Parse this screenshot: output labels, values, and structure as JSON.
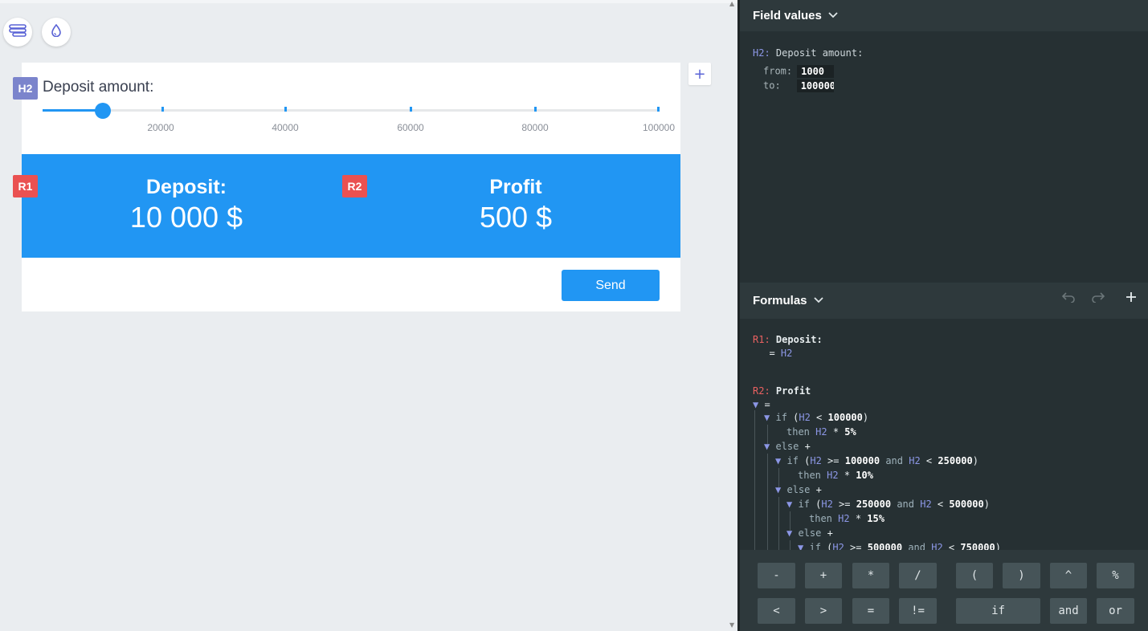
{
  "builder": {
    "field": {
      "badge": "H2",
      "label": "Deposit amount:",
      "slider_value": 10000,
      "slider_min": 1000,
      "slider_max": 100000,
      "ticks": [
        "20000",
        "40000",
        "60000",
        "80000",
        "100000"
      ]
    },
    "results": [
      {
        "badge": "R1",
        "title": "Deposit:",
        "value": "10 000 $"
      },
      {
        "badge": "R2",
        "title": "Profit",
        "value": "500 $"
      }
    ],
    "send_label": "Send",
    "add_label": "+"
  },
  "field_values": {
    "header": "Field values",
    "ref": "H2:",
    "name": "Deposit amount:",
    "from_label": "from:",
    "from_value": "1000",
    "to_label": "to:",
    "to_value": "100000"
  },
  "formulas": {
    "header": "Formulas",
    "r1_id": "R1:",
    "r1_name": "Deposit:",
    "r1_expr_eq": "=",
    "r1_expr_ref": "H2",
    "r2_id": "R2:",
    "r2_name": "Profit"
  },
  "keypad": {
    "row1": [
      "-",
      "+",
      "*",
      "/",
      "(",
      ")",
      "^",
      "%"
    ],
    "row2": [
      "<",
      ">",
      "=",
      "!=",
      "if",
      "and",
      "or"
    ]
  }
}
